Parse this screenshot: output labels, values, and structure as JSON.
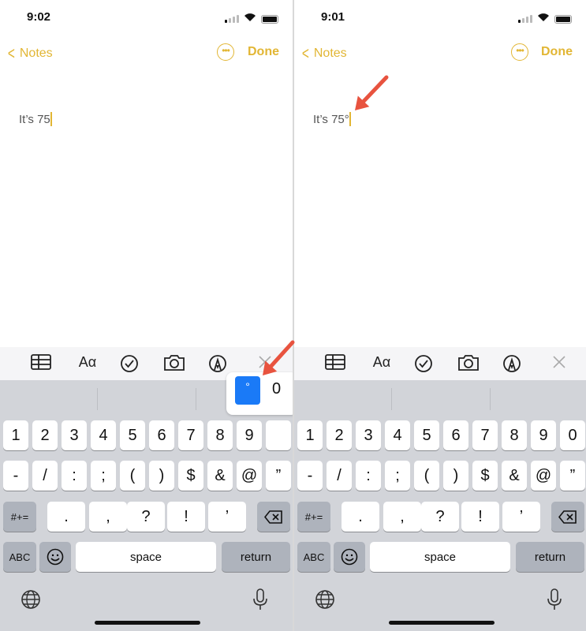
{
  "accent": "#e2b634",
  "arrow_color": "#e8533f",
  "popup_color": "#1a7af7",
  "panels": [
    {
      "time": "9:02",
      "back_label": "Notes",
      "done_label": "Done",
      "note_text": "It’s 75",
      "popup": {
        "selected": "°",
        "other": "0"
      }
    },
    {
      "time": "9:01",
      "back_label": "Notes",
      "done_label": "Done",
      "note_text": "It’s 75°",
      "popup": null
    }
  ],
  "toolbar": [
    "table-icon",
    "Aα",
    "checklist-icon",
    "camera-icon",
    "markup-icon",
    "close-icon"
  ],
  "keyboard": {
    "row1": [
      "1",
      "2",
      "3",
      "4",
      "5",
      "6",
      "7",
      "8",
      "9",
      "0"
    ],
    "row2": [
      "-",
      "/",
      ":",
      ";",
      "(",
      ")",
      "$",
      "&",
      "@",
      "”"
    ],
    "row3": [
      "#+=",
      ".",
      ",",
      "?",
      "!",
      "’",
      "delete-icon"
    ],
    "row4": [
      "ABC",
      "emoji-icon",
      "space",
      "return"
    ],
    "bottom": [
      "globe-icon",
      "microphone-icon"
    ]
  }
}
